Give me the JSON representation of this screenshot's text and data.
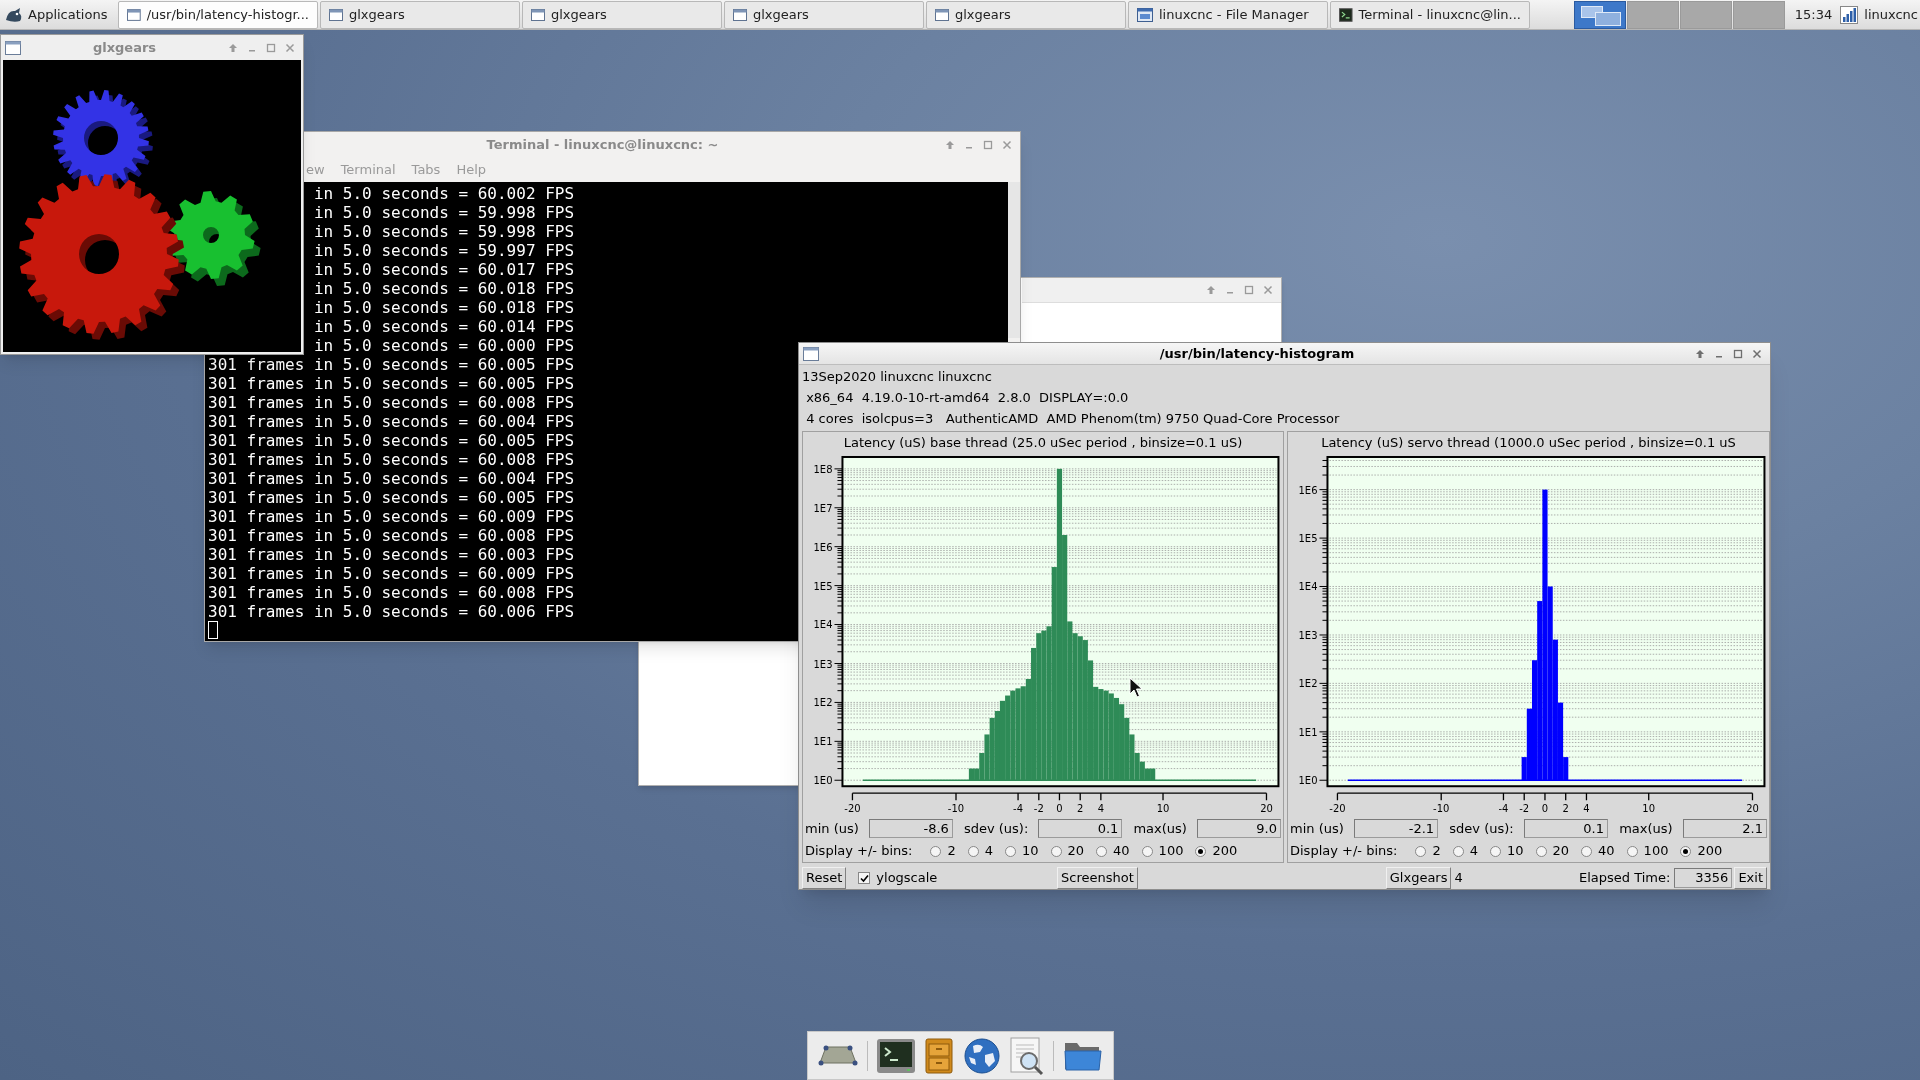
{
  "top_panel": {
    "menu": "Applications",
    "tasks": [
      {
        "label": "/usr/bin/latency-histogr...",
        "kind": "window",
        "selected": true
      },
      {
        "label": "glxgears",
        "kind": "window",
        "selected": false
      },
      {
        "label": "glxgears",
        "kind": "window",
        "selected": false
      },
      {
        "label": "glxgears",
        "kind": "window",
        "selected": false
      },
      {
        "label": "glxgears",
        "kind": "window",
        "selected": false
      },
      {
        "label": "linuxcnc - File Manager",
        "kind": "file-manager",
        "selected": false
      },
      {
        "label": "Terminal - linuxcnc@lin...",
        "kind": "terminal",
        "selected": false
      }
    ],
    "workspaces": [
      {
        "selected": true
      },
      {
        "selected": false
      },
      {
        "selected": false
      },
      {
        "selected": false
      }
    ],
    "clock": "15:34",
    "user": "linuxcnc"
  },
  "glxgears_window": {
    "title": "glxgears"
  },
  "terminal_window": {
    "title": "Terminal - linuxcnc@linuxcnc: ~",
    "menu": [
      "ew",
      "Terminal",
      "Tabs",
      "Help"
    ],
    "lines": [
      {
        "kind": "covered",
        "text": "in 5.0 seconds = 60.002 FPS"
      },
      {
        "kind": "covered",
        "text": "in 5.0 seconds = 59.998 FPS"
      },
      {
        "kind": "covered",
        "text": "in 5.0 seconds = 59.998 FPS"
      },
      {
        "kind": "covered",
        "text": "in 5.0 seconds = 59.997 FPS"
      },
      {
        "kind": "covered",
        "text": "in 5.0 seconds = 60.017 FPS"
      },
      {
        "kind": "covered",
        "text": "in 5.0 seconds = 60.018 FPS"
      },
      {
        "kind": "covered",
        "text": "in 5.0 seconds = 60.018 FPS"
      },
      {
        "kind": "covered",
        "text": "in 5.0 seconds = 60.014 FPS"
      },
      {
        "kind": "covered",
        "text": "in 5.0 seconds = 60.000 FPS"
      },
      {
        "kind": "full",
        "text": "301 frames in 5.0 seconds = 60.005 FPS"
      },
      {
        "kind": "full",
        "text": "301 frames in 5.0 seconds = 60.005 FPS"
      },
      {
        "kind": "full",
        "text": "301 frames in 5.0 seconds = 60.008 FPS"
      },
      {
        "kind": "full",
        "text": "301 frames in 5.0 seconds = 60.004 FPS"
      },
      {
        "kind": "full",
        "text": "301 frames in 5.0 seconds = 60.005 FPS"
      },
      {
        "kind": "full",
        "text": "301 frames in 5.0 seconds = 60.008 FPS"
      },
      {
        "kind": "full",
        "text": "301 frames in 5.0 seconds = 60.004 FPS"
      },
      {
        "kind": "full",
        "text": "301 frames in 5.0 seconds = 60.005 FPS"
      },
      {
        "kind": "full",
        "text": "301 frames in 5.0 seconds = 60.009 FPS"
      },
      {
        "kind": "full",
        "text": "301 frames in 5.0 seconds = 60.008 FPS"
      },
      {
        "kind": "full",
        "text": "301 frames in 5.0 seconds = 60.003 FPS"
      },
      {
        "kind": "full",
        "text": "301 frames in 5.0 seconds = 60.009 FPS"
      },
      {
        "kind": "full",
        "text": "301 frames in 5.0 seconds = 60.008 FPS"
      },
      {
        "kind": "full",
        "text": "301 frames in 5.0 seconds = 60.006 FPS"
      }
    ]
  },
  "histogram_window": {
    "title": "/usr/bin/latency-histogram",
    "info": [
      "13Sep2020 linuxcnc linuxcnc",
      " x86_64  4.19.0-10-rt-amd64  2.8.0  DISPLAY=:0.0",
      " 4 cores  isolcpus=3   AuthenticAMD  AMD Phenom(tm) 9750 Quad-Core Processor"
    ],
    "panels": [
      {
        "title": "Latency (uS) base thread (25.0 uSec period , binsize=0.1 uS)",
        "color": "#2e8b57",
        "y_labels": [
          "1E8",
          "1E7",
          "1E6",
          "1E5",
          "1E4",
          "1E3",
          "1E2",
          "1E1",
          "1E0"
        ],
        "x_labels": [
          "-20",
          "-10",
          "-4",
          "-2",
          "0",
          "2",
          "4",
          "10",
          "20"
        ],
        "stats": [
          {
            "label": "min (us)",
            "value": "-8.6"
          },
          {
            "label": "sdev (us):",
            "value": "0.1"
          },
          {
            "label": "max(us)",
            "value": "9.0"
          }
        ],
        "bins_label": "Display +/- bins:",
        "bins": [
          {
            "label": "2",
            "selected": false
          },
          {
            "label": "4",
            "selected": false
          },
          {
            "label": "10",
            "selected": false
          },
          {
            "label": "20",
            "selected": false
          },
          {
            "label": "40",
            "selected": false
          },
          {
            "label": "100",
            "selected": false
          },
          {
            "label": "200",
            "selected": true
          }
        ]
      },
      {
        "title": "Latency (uS) servo thread (1000.0 uSec period , binsize=0.1 uS",
        "color": "#0000ff",
        "y_labels": [
          "1E6",
          "1E5",
          "1E4",
          "1E3",
          "1E2",
          "1E1",
          "1E0"
        ],
        "x_labels": [
          "-20",
          "-10",
          "-4",
          "-2",
          "0",
          "2",
          "4",
          "10",
          "20"
        ],
        "stats": [
          {
            "label": "min (us)",
            "value": "-2.1"
          },
          {
            "label": "sdev (us):",
            "value": "0.1"
          },
          {
            "label": "max(us)",
            "value": "2.1"
          }
        ],
        "bins_label": "Display +/- bins:",
        "bins": [
          {
            "label": "2",
            "selected": false
          },
          {
            "label": "4",
            "selected": false
          },
          {
            "label": "10",
            "selected": false
          },
          {
            "label": "20",
            "selected": false
          },
          {
            "label": "40",
            "selected": false
          },
          {
            "label": "100",
            "selected": false
          },
          {
            "label": "200",
            "selected": true
          }
        ]
      }
    ],
    "footer": {
      "reset": "Reset",
      "logscale": {
        "label": "ylogscale",
        "checked": true
      },
      "screenshot": "Screenshot",
      "glxgears": "Glxgears",
      "glxgears_count": "4",
      "elapsed_label": "Elapsed Time:",
      "elapsed": "3356",
      "exit": "Exit"
    }
  }
}
